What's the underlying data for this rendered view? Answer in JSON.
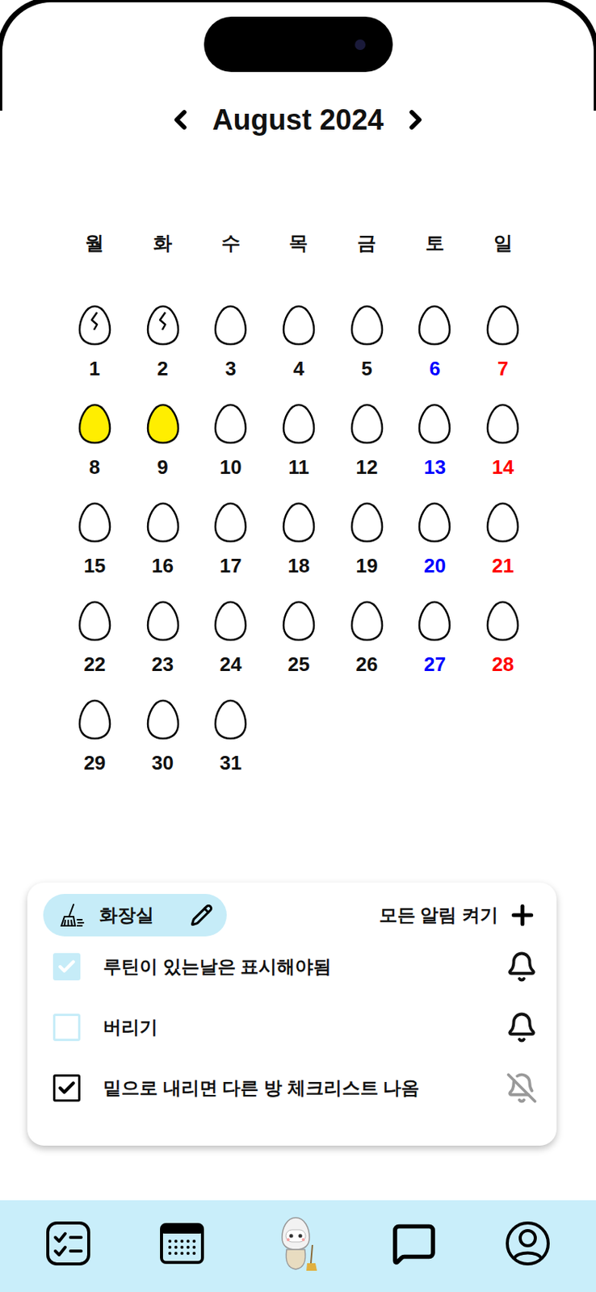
{
  "header": {
    "month": "August 2024"
  },
  "weekdays": [
    "월",
    "화",
    "수",
    "목",
    "금",
    "토",
    "일"
  ],
  "days": [
    {
      "day": "1",
      "egg": "cracked",
      "color": "#111111"
    },
    {
      "day": "2",
      "egg": "cracked",
      "color": "#111111"
    },
    {
      "day": "3",
      "egg": "empty",
      "color": "#111111"
    },
    {
      "day": "4",
      "egg": "empty",
      "color": "#111111"
    },
    {
      "day": "5",
      "egg": "empty",
      "color": "#111111"
    },
    {
      "day": "6",
      "egg": "empty",
      "color": "#0000ff"
    },
    {
      "day": "7",
      "egg": "empty",
      "color": "#ff0000"
    },
    {
      "day": "8",
      "egg": "filled",
      "color": "#111111"
    },
    {
      "day": "9",
      "egg": "filled",
      "color": "#111111"
    },
    {
      "day": "10",
      "egg": "empty",
      "color": "#111111"
    },
    {
      "day": "11",
      "egg": "empty",
      "color": "#111111"
    },
    {
      "day": "12",
      "egg": "empty",
      "color": "#111111"
    },
    {
      "day": "13",
      "egg": "empty",
      "color": "#0000ff"
    },
    {
      "day": "14",
      "egg": "empty",
      "color": "#ff0000"
    },
    {
      "day": "15",
      "egg": "empty",
      "color": "#111111"
    },
    {
      "day": "16",
      "egg": "empty",
      "color": "#111111"
    },
    {
      "day": "17",
      "egg": "empty",
      "color": "#111111"
    },
    {
      "day": "18",
      "egg": "empty",
      "color": "#111111"
    },
    {
      "day": "19",
      "egg": "empty",
      "color": "#111111"
    },
    {
      "day": "20",
      "egg": "empty",
      "color": "#0000ff"
    },
    {
      "day": "21",
      "egg": "empty",
      "color": "#ff0000"
    },
    {
      "day": "22",
      "egg": "empty",
      "color": "#111111"
    },
    {
      "day": "23",
      "egg": "empty",
      "color": "#111111"
    },
    {
      "day": "24",
      "egg": "empty",
      "color": "#111111"
    },
    {
      "day": "25",
      "egg": "empty",
      "color": "#111111"
    },
    {
      "day": "26",
      "egg": "empty",
      "color": "#111111"
    },
    {
      "day": "27",
      "egg": "empty",
      "color": "#0000ff"
    },
    {
      "day": "28",
      "egg": "empty",
      "color": "#ff0000"
    },
    {
      "day": "29",
      "egg": "empty",
      "color": "#111111"
    },
    {
      "day": "30",
      "egg": "empty",
      "color": "#111111"
    },
    {
      "day": "31",
      "egg": "empty",
      "color": "#111111"
    }
  ],
  "checklist": {
    "room": "화장실",
    "all_alarms": "모든 알림 켜기",
    "items": [
      {
        "text": "루틴이 있는날은 표시해야됨",
        "checked": true,
        "color": "#c6ecf8",
        "alarm": true
      },
      {
        "text": "버리기",
        "checked": false,
        "color": "#c6ecf8",
        "alarm": true
      },
      {
        "text": "밑으로 내리면 다른 방 체크리스트 나옴",
        "checked": true,
        "color": "#000000",
        "alarm": false
      }
    ]
  }
}
